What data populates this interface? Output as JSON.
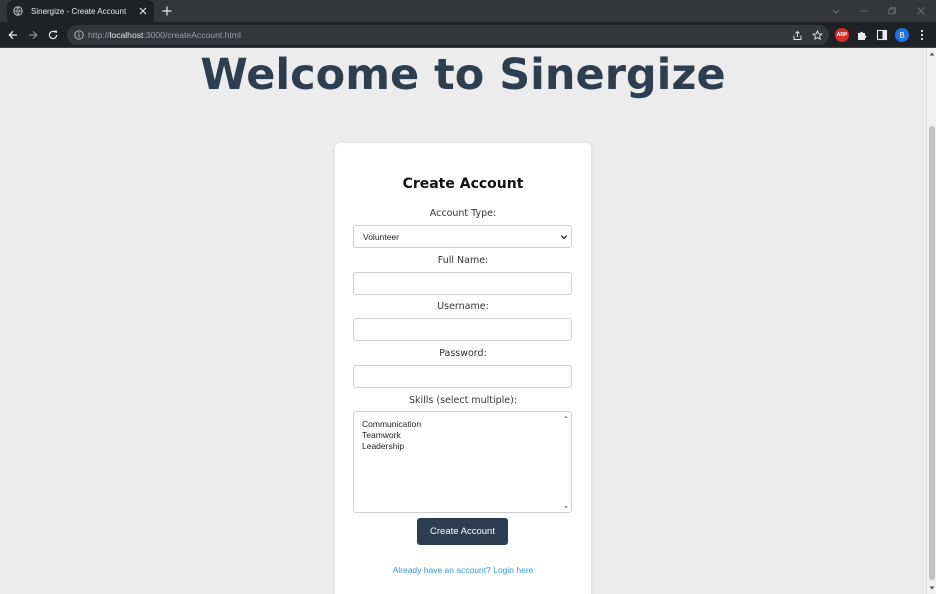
{
  "browser": {
    "tab_title": "Sinergize - Create Account",
    "url_scheme": "http://",
    "url_host": "localhost",
    "url_rest": ":3000/createAccount.html",
    "extension_abp_label": "ABP",
    "profile_initial": "B"
  },
  "page": {
    "title": "Welcome to Sinergize"
  },
  "form": {
    "title": "Create Account",
    "account_type_label": "Account Type:",
    "account_type_selected": "Volunteer",
    "full_name_label": "Full Name:",
    "full_name_value": "",
    "username_label": "Username:",
    "username_value": "",
    "password_label": "Password:",
    "password_value": "",
    "skills_label": "Skills (select multiple):",
    "skills_options": [
      "Communication",
      "Teamwork",
      "Leadership"
    ],
    "submit_label": "Create Account",
    "login_link": "Already have an account? Login here"
  },
  "colors": {
    "title": "#2c3e50",
    "button": "#2c3e50",
    "link": "#3498db",
    "background": "#ececec"
  }
}
